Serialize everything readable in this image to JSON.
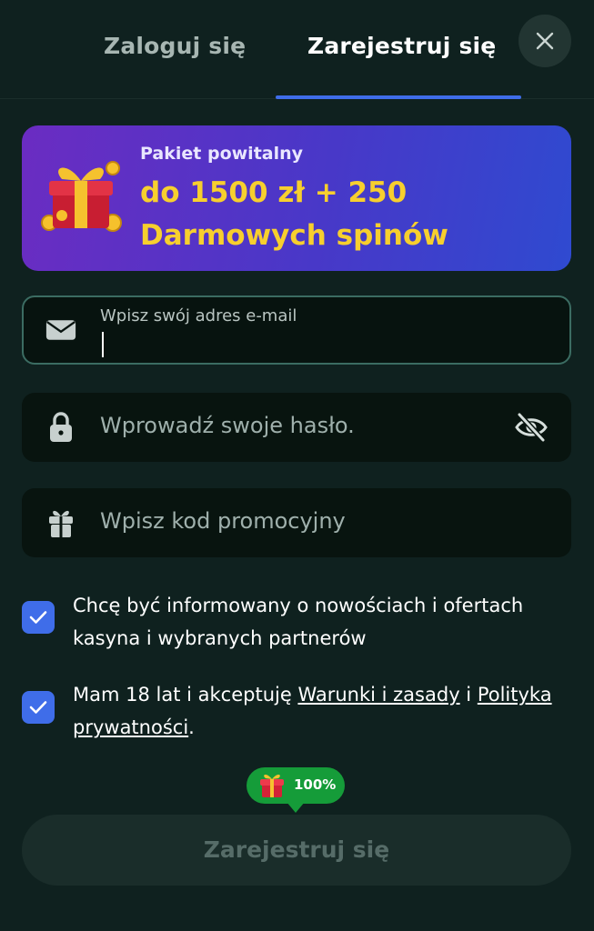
{
  "tabs": {
    "login": "Zaloguj się",
    "register": "Zarejestruj się"
  },
  "banner": {
    "subtitle": "Pakiet powitalny",
    "line1": "do 1500 zł + 250",
    "line2": "Darmowych spinów"
  },
  "form": {
    "email": {
      "label": "Wpisz swój adres e-mail",
      "value": ""
    },
    "password": {
      "placeholder": "Wprowadź swoje hasło."
    },
    "promo": {
      "placeholder": "Wpisz kod promocyjny"
    }
  },
  "consents": {
    "newsletter": {
      "text": "Chcę być informowany o nowościach i ofertach kasyna i wybranych partnerów",
      "checked": true
    },
    "age": {
      "prefix": "Mam 18 lat i akceptuję ",
      "terms_link": "Warunki i zasady",
      "middle": " i ",
      "privacy_link": "Polityka prywatności",
      "suffix": ".",
      "checked": true
    }
  },
  "progress": {
    "label": "100%",
    "value": 1.0
  },
  "submit": {
    "label": "Zarejestruj się"
  },
  "icons": {
    "close": "close-icon",
    "email": "envelope-icon",
    "password": "lock-icon",
    "visibility": "eye-off-icon",
    "promo": "gift-icon",
    "check": "check-icon"
  },
  "colors": {
    "background": "#0f211f",
    "accent": "#3f6de9",
    "banner_text": "#f7cf2e",
    "progress": "#159c39"
  }
}
